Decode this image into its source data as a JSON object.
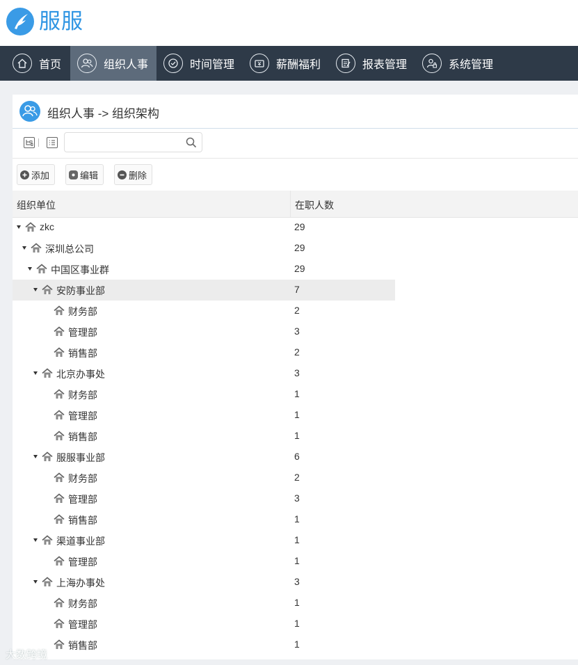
{
  "app": {
    "title": "服服"
  },
  "nav": {
    "items": [
      {
        "label": "首页",
        "icon": "home-icon",
        "active": false
      },
      {
        "label": "组织人事",
        "icon": "people-icon",
        "active": true
      },
      {
        "label": "时间管理",
        "icon": "clock-icon",
        "active": false
      },
      {
        "label": "薪酬福利",
        "icon": "money-icon",
        "active": false
      },
      {
        "label": "报表管理",
        "icon": "report-icon",
        "active": false
      },
      {
        "label": "系统管理",
        "icon": "user-lock-icon",
        "active": false
      }
    ]
  },
  "panel": {
    "title": "组织人事 -> 组织架构"
  },
  "search": {
    "value": "",
    "placeholder": ""
  },
  "actions": {
    "add": "添加",
    "edit": "编辑",
    "delete": "删除"
  },
  "grid": {
    "columns": [
      "组织单位",
      "在职人数"
    ],
    "rows": [
      {
        "name": "zkc",
        "count": "29",
        "level": 0,
        "expanded": true
      },
      {
        "name": "深圳总公司",
        "count": "29",
        "level": 1,
        "expanded": true
      },
      {
        "name": "中国区事业群",
        "count": "29",
        "level": 2,
        "expanded": true
      },
      {
        "name": "安防事业部",
        "count": "7",
        "level": 3,
        "expanded": true,
        "selected": true
      },
      {
        "name": "财务部",
        "count": "2",
        "level": 4
      },
      {
        "name": "管理部",
        "count": "3",
        "level": 4
      },
      {
        "name": "销售部",
        "count": "2",
        "level": 4
      },
      {
        "name": "北京办事处",
        "count": "3",
        "level": 3,
        "expanded": true
      },
      {
        "name": "财务部",
        "count": "1",
        "level": 4
      },
      {
        "name": "管理部",
        "count": "1",
        "level": 4
      },
      {
        "name": "销售部",
        "count": "1",
        "level": 4
      },
      {
        "name": "服服事业部",
        "count": "6",
        "level": 3,
        "expanded": true
      },
      {
        "name": "财务部",
        "count": "2",
        "level": 4
      },
      {
        "name": "管理部",
        "count": "3",
        "level": 4
      },
      {
        "name": "销售部",
        "count": "1",
        "level": 4
      },
      {
        "name": "渠道事业部",
        "count": "1",
        "level": 3,
        "expanded": true
      },
      {
        "name": "管理部",
        "count": "1",
        "level": 4
      },
      {
        "name": "上海办事处",
        "count": "3",
        "level": 3,
        "expanded": true
      },
      {
        "name": "财务部",
        "count": "1",
        "level": 4
      },
      {
        "name": "管理部",
        "count": "1",
        "level": 4
      },
      {
        "name": "销售部",
        "count": "1",
        "level": 4
      }
    ]
  },
  "watermark": "大数跨境",
  "colors": {
    "brand": "#3a9be6",
    "nav_bg": "#2e3a48",
    "nav_active": "#5d6b7b"
  }
}
